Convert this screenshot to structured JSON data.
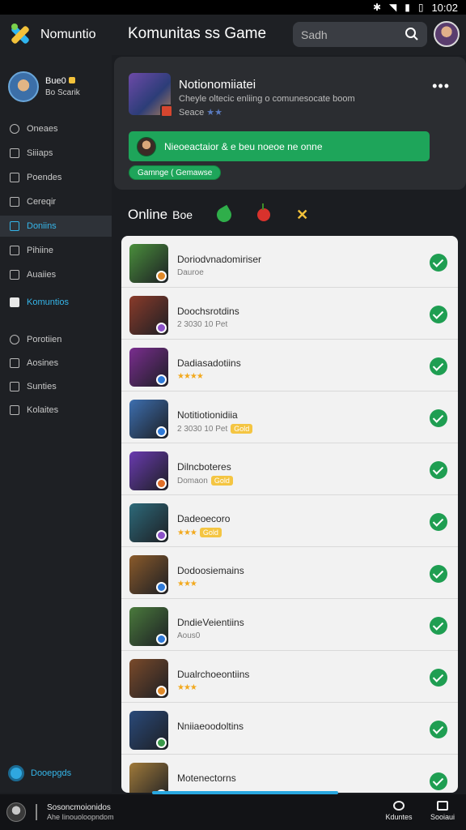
{
  "status_bar": {
    "time": "10:02",
    "icons": [
      "bluetooth-icon",
      "wifi-icon",
      "signal-icon",
      "battery-icon"
    ]
  },
  "header": {
    "logo_text": "Nomuntio",
    "title": "Komunitas ss Game",
    "search_placeholder": "Sadh"
  },
  "sidebar": {
    "profile": {
      "name": "Bue0",
      "sub": "Bo Scarik"
    },
    "items": [
      {
        "label": "Oneaes",
        "icon": "activity-icon"
      },
      {
        "label": "Siiiaps",
        "icon": "games-icon"
      },
      {
        "label": "Poendes",
        "icon": "library-icon"
      },
      {
        "label": "Cereqir",
        "icon": "store-icon"
      },
      {
        "label": "Doniins",
        "icon": "friends-icon",
        "active": true
      },
      {
        "label": "Pihiine",
        "icon": "messages-icon"
      },
      {
        "label": "Auaiies",
        "icon": "groups-icon"
      },
      {
        "label": "Komuntios",
        "icon": "community-icon",
        "highlight": true
      },
      {
        "label": "Porotiien",
        "icon": "profile-icon"
      },
      {
        "label": "Aosines",
        "icon": "achievements-icon"
      },
      {
        "label": "Sunties",
        "icon": "settings-icon"
      },
      {
        "label": "Kolaites",
        "icon": "help-icon"
      }
    ],
    "footer": {
      "label": "Dooepgds"
    }
  },
  "notification": {
    "title": "Notionomiiatei",
    "description": "Cheyle oltecic enliing o comunesocate boom",
    "meta": "Seace",
    "banner_text": "Nieoeactaior & e beu noeoe ne onne",
    "tag_text": "Gamnge ( Gemawse"
  },
  "online": {
    "label": "Online",
    "sub": "Boe"
  },
  "list": [
    {
      "name": "Doriodvnadomiriser",
      "meta": "Dauroe",
      "badge": "",
      "stars": "",
      "thumb_color": "#4a8f3c",
      "badge_dot": "#e08a2a"
    },
    {
      "name": "Doochsrotdins",
      "meta": "2 3030 10 Pet",
      "badge": "",
      "stars": "",
      "thumb_color": "#8a3b2a",
      "badge_dot": "#8c52c8"
    },
    {
      "name": "Dadiasadotiins",
      "meta": "",
      "badge": "",
      "stars": "★★★★",
      "thumb_color": "#7a2d8f",
      "badge_dot": "#2f7ad8"
    },
    {
      "name": "Notitiotionidiia",
      "meta": "2 3030 10 Pet",
      "badge": "Gold",
      "stars": "",
      "thumb_color": "#3d6fb0",
      "badge_dot": "#2f7ad8"
    },
    {
      "name": "Dilncboteres",
      "meta": "Domaon",
      "badge": "Gold",
      "stars": "",
      "thumb_color": "#6a3bb0",
      "badge_dot": "#e0702a"
    },
    {
      "name": "Dadeoecoro",
      "meta": "",
      "badge": "Gold",
      "stars": "★★★",
      "thumb_color": "#2d6a7a",
      "badge_dot": "#8c52c8"
    },
    {
      "name": "Dodoosiemains",
      "meta": "",
      "badge": "",
      "stars": "★★★",
      "thumb_color": "#8a5a2a",
      "badge_dot": "#2f7ad8"
    },
    {
      "name": "DndieVeientiins",
      "meta": "Aous0",
      "badge": "",
      "stars": "",
      "thumb_color": "#4a7a3c",
      "badge_dot": "#2f7ad8"
    },
    {
      "name": "Dualrchoeontiins",
      "meta": "",
      "badge": "",
      "stars": "★★★",
      "thumb_color": "#7a4a2a",
      "badge_dot": "#e08a2a"
    },
    {
      "name": "Nniiaeoodoltins",
      "meta": "",
      "badge": "",
      "stars": "",
      "thumb_color": "#2a4a7a",
      "badge_dot": "#3a9a4a"
    },
    {
      "name": "Motenectorns",
      "meta": "",
      "badge": "",
      "stars": "",
      "thumb_color": "#a07a3a",
      "badge_dot": "#e08a2a"
    }
  ],
  "bottom_bar": {
    "text1": "Sosoncmoionidos",
    "text2": "Ahe Iinouoloopndom",
    "btn1_label": "Kduntes",
    "btn2_label": "Sooiaui"
  },
  "colors": {
    "accent": "#35b6ea",
    "success": "#1f9e52",
    "card": "#2b2d31"
  }
}
